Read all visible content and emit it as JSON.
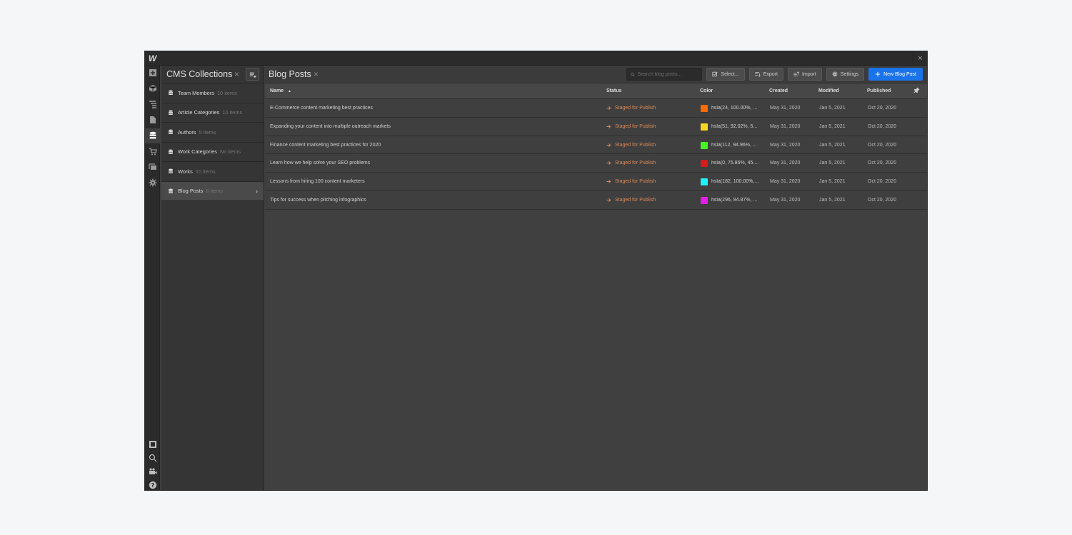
{
  "app": {
    "logo": "W",
    "close_icon": "×"
  },
  "rail": {
    "top_icons": [
      "add-icon",
      "components-icon",
      "navigator-icon",
      "pages-icon",
      "cms-icon",
      "ecommerce-icon",
      "assets-icon",
      "settings-icon"
    ],
    "bottom_icons": [
      "preview-icon",
      "search-icon",
      "video-icon",
      "help-icon"
    ],
    "active": "cms-icon"
  },
  "collections": {
    "title": "CMS Collections",
    "close": "×",
    "add_icon": "≡+",
    "items": [
      {
        "name": "Team Members",
        "count": "10 items"
      },
      {
        "name": "Article Categories",
        "count": "10 items"
      },
      {
        "name": "Authors",
        "count": "5 items"
      },
      {
        "name": "Work Categories",
        "count": "No items"
      },
      {
        "name": "Works",
        "count": "10 items"
      },
      {
        "name": "Blog Posts",
        "count": "6 items",
        "active": true
      }
    ],
    "chevron": "›"
  },
  "main": {
    "title": "Blog Posts",
    "close": "×",
    "search_placeholder": "Search blog posts...",
    "buttons": {
      "select": "Select...",
      "export": "Export",
      "import": "Import",
      "settings": "Settings",
      "new": "New Blog Post"
    },
    "columns": {
      "name": "Name",
      "sort_indicator": "▲",
      "status": "Status",
      "color": "Color",
      "created": "Created",
      "modified": "Modified",
      "published": "Published"
    },
    "rows": [
      {
        "name": "E-Commerce content marketing best practices",
        "status": "Staged for Publish",
        "swatch": "#ff6a00",
        "color": "hsla(24, 100.00%, ...",
        "created": "May 31, 2020",
        "modified": "Jan 5, 2021",
        "published": "Oct 20, 2020"
      },
      {
        "name": "Expanding your content into multiple outreach markets",
        "status": "Staged for Publish",
        "swatch": "#f6d523",
        "color": "hsla(51, 92.02%, 5...",
        "created": "May 31, 2020",
        "modified": "Jan 5, 2021",
        "published": "Oct 20, 2020"
      },
      {
        "name": "Finance content marketing best practices for 2020",
        "status": "Staged for Publish",
        "swatch": "#45f521",
        "color": "hsla(112, 94.96%, ...",
        "created": "May 31, 2020",
        "modified": "Jan 5, 2021",
        "published": "Oct 20, 2020"
      },
      {
        "name": "Learn how we help solve your SEO problems",
        "status": "Staged for Publish",
        "swatch": "#d41c1c",
        "color": "hsla(0, 75.86%, 45....",
        "created": "May 31, 2020",
        "modified": "Jan 5, 2021",
        "published": "Oct 20, 2020"
      },
      {
        "name": "Lessons from hiring 100 content marketers",
        "status": "Staged for Publish",
        "swatch": "#1ef2f7",
        "color": "hsla(182, 100.00%, ...",
        "created": "May 31, 2020",
        "modified": "Jan 5, 2021",
        "published": "Oct 20, 2020"
      },
      {
        "name": "Tips for success when pitching infographics",
        "status": "Staged for Publish",
        "swatch": "#e21ee8",
        "color": "hsla(296, 84.87%, ...",
        "created": "May 31, 2020",
        "modified": "Jan 5, 2021",
        "published": "Oct 20, 2020"
      }
    ]
  },
  "colors": {
    "accent": "#1a73e8",
    "status": "#d9895a"
  }
}
